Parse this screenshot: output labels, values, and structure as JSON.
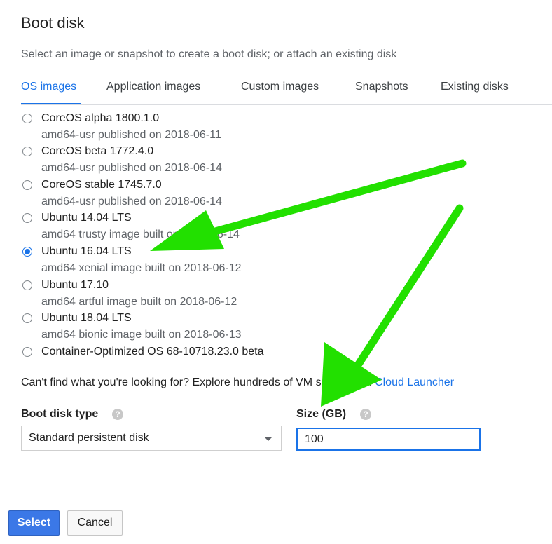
{
  "header": {
    "title": "Boot disk",
    "subtitle": "Select an image or snapshot to create a boot disk; or attach an existing disk"
  },
  "tabs": [
    {
      "label": "OS images",
      "active": true
    },
    {
      "label": "Application images",
      "active": false
    },
    {
      "label": "Custom images",
      "active": false
    },
    {
      "label": "Snapshots",
      "active": false
    },
    {
      "label": "Existing disks",
      "active": false
    }
  ],
  "images": [
    {
      "name": "CoreOS alpha 1800.1.0",
      "desc": "amd64-usr published on 2018-06-11",
      "selected": false
    },
    {
      "name": "CoreOS beta 1772.4.0",
      "desc": "amd64-usr published on 2018-06-14",
      "selected": false
    },
    {
      "name": "CoreOS stable 1745.7.0",
      "desc": "amd64-usr published on 2018-06-14",
      "selected": false
    },
    {
      "name": "Ubuntu 14.04 LTS",
      "desc": "amd64 trusty image built on 2018-06-14",
      "selected": false
    },
    {
      "name": "Ubuntu 16.04 LTS",
      "desc": "amd64 xenial image built on 2018-06-12",
      "selected": true
    },
    {
      "name": "Ubuntu 17.10",
      "desc": "amd64 artful image built on 2018-06-12",
      "selected": false
    },
    {
      "name": "Ubuntu 18.04 LTS",
      "desc": "amd64 bionic image built on 2018-06-13",
      "selected": false
    },
    {
      "name": "Container-Optimized OS 68-10718.23.0 beta",
      "desc": "",
      "selected": false
    }
  ],
  "hint": {
    "text": "Can't find what you're looking for? Explore hundreds of VM solutions in ",
    "link": "Cloud Launcher"
  },
  "disk_type": {
    "label": "Boot disk type",
    "help": "?",
    "value": "Standard persistent disk"
  },
  "size": {
    "label": "Size (GB)",
    "help": "?",
    "value": "100"
  },
  "buttons": {
    "select": "Select",
    "cancel": "Cancel"
  },
  "colors": {
    "accent": "#1a73e8",
    "annotation_arrow": "#22e000"
  }
}
